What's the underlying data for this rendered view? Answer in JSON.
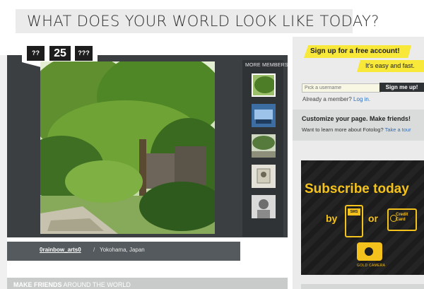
{
  "header": {
    "title": "WHAT DOES YOUR WORLD LOOK LIKE TODAY?"
  },
  "date": {
    "month": "??",
    "day": "25",
    "year": "???"
  },
  "viewer": {
    "more_members_label": "MORE MEMBERS",
    "photo_icon": "forest-garden-photo",
    "thumbnails": [
      {
        "name": "thumb-tree",
        "selected": true
      },
      {
        "name": "thumb-room",
        "selected": false
      },
      {
        "name": "thumb-garden",
        "selected": false
      },
      {
        "name": "thumb-device",
        "selected": false
      },
      {
        "name": "thumb-portrait",
        "selected": false
      }
    ]
  },
  "caption": {
    "username": "0rainbow_arts0",
    "separator": "/",
    "location": "Yokohama, Japan"
  },
  "bottom_bar": {
    "bold": "MAKE FRIENDS",
    "rest": " AROUND THE WORLD"
  },
  "signup": {
    "headline": "Sign up for a free account!",
    "subline": "It's easy and fast.",
    "username_placeholder": "Pick a username",
    "submit_label": "Sign me up!",
    "member_prompt": "Already a member?",
    "login_link": "Log in."
  },
  "customize": {
    "title": "Customize your page. Make friends!",
    "prompt": "Want to learn more about Fotolog?",
    "tour_link": "Take a tour"
  },
  "ad": {
    "headline": "Subscribe today",
    "by": "by",
    "sms": "SMS",
    "or": "or",
    "card_label_1": "Credit",
    "card_label_2": "Card",
    "camera_label": "GOLD CAMERA"
  },
  "colors": {
    "accent_yellow": "#f8e83a",
    "ad_gold": "#f4c21c",
    "link_blue": "#2a6fbf",
    "viewer_bg": "#3b3f42"
  }
}
